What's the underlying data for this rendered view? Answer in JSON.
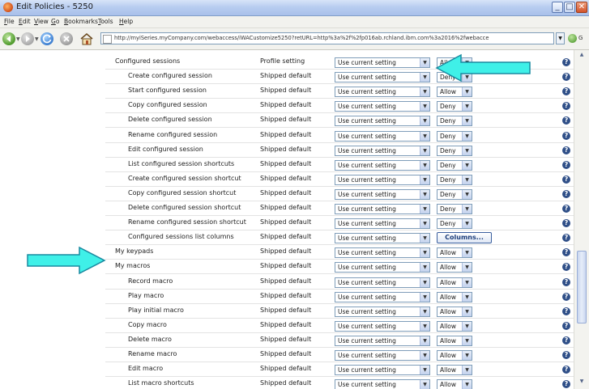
{
  "window": {
    "title": "Edit Policies - 5250"
  },
  "menu": [
    "File",
    "Edit",
    "View",
    "Go",
    "Bookmarks",
    "Tools",
    "Help"
  ],
  "address": {
    "url": "http://myiSeries.myCompany.com/webaccess/iWACustomize5250?retURL=http%3a%2f%2fp016ab.rchland.ibm.com%3a2016%2fwebacce",
    "go_label": "G"
  },
  "rows": [
    {
      "name": "Configured sessions",
      "indent": 0,
      "profile": "Profile setting",
      "setting": "Use current setting",
      "perm": "Allow"
    },
    {
      "name": "Create configured session",
      "indent": 1,
      "profile": "Shipped default",
      "setting": "Use current setting",
      "perm": "Deny"
    },
    {
      "name": "Start configured session",
      "indent": 1,
      "profile": "Shipped default",
      "setting": "Use current setting",
      "perm": "Allow"
    },
    {
      "name": "Copy configured session",
      "indent": 1,
      "profile": "Shipped default",
      "setting": "Use current setting",
      "perm": "Deny"
    },
    {
      "name": "Delete configured session",
      "indent": 1,
      "profile": "Shipped default",
      "setting": "Use current setting",
      "perm": "Deny"
    },
    {
      "name": "Rename configured session",
      "indent": 1,
      "profile": "Shipped default",
      "setting": "Use current setting",
      "perm": "Deny"
    },
    {
      "name": "Edit configured session",
      "indent": 1,
      "profile": "Shipped default",
      "setting": "Use current setting",
      "perm": "Deny"
    },
    {
      "name": "List configured session shortcuts",
      "indent": 1,
      "profile": "Shipped default",
      "setting": "Use current setting",
      "perm": "Deny"
    },
    {
      "name": "Create configured session shortcut",
      "indent": 1,
      "profile": "Shipped default",
      "setting": "Use current setting",
      "perm": "Deny"
    },
    {
      "name": "Copy configured session shortcut",
      "indent": 1,
      "profile": "Shipped default",
      "setting": "Use current setting",
      "perm": "Deny"
    },
    {
      "name": "Delete configured session shortcut",
      "indent": 1,
      "profile": "Shipped default",
      "setting": "Use current setting",
      "perm": "Deny"
    },
    {
      "name": "Rename configured session shortcut",
      "indent": 1,
      "profile": "Shipped default",
      "setting": "Use current setting",
      "perm": "Deny"
    },
    {
      "name": "Configured sessions list columns",
      "indent": 1,
      "profile": "Shipped default",
      "setting": "Use current setting",
      "button": "Columns..."
    },
    {
      "name": "My keypads",
      "indent": 0,
      "profile": "Shipped default",
      "setting": "Use current setting",
      "perm": "Allow"
    },
    {
      "name": "My macros",
      "indent": 0,
      "profile": "Shipped default",
      "setting": "Use current setting",
      "perm": "Allow"
    },
    {
      "name": "Record macro",
      "indent": 1,
      "profile": "Shipped default",
      "setting": "Use current setting",
      "perm": "Allow"
    },
    {
      "name": "Play macro",
      "indent": 1,
      "profile": "Shipped default",
      "setting": "Use current setting",
      "perm": "Allow"
    },
    {
      "name": "Play initial macro",
      "indent": 1,
      "profile": "Shipped default",
      "setting": "Use current setting",
      "perm": "Allow"
    },
    {
      "name": "Copy macro",
      "indent": 1,
      "profile": "Shipped default",
      "setting": "Use current setting",
      "perm": "Allow"
    },
    {
      "name": "Delete macro",
      "indent": 1,
      "profile": "Shipped default",
      "setting": "Use current setting",
      "perm": "Allow"
    },
    {
      "name": "Rename macro",
      "indent": 1,
      "profile": "Shipped default",
      "setting": "Use current setting",
      "perm": "Allow"
    },
    {
      "name": "Edit macro",
      "indent": 1,
      "profile": "Shipped default",
      "setting": "Use current setting",
      "perm": "Allow"
    },
    {
      "name": "List macro shortcuts",
      "indent": 1,
      "profile": "Shipped default",
      "setting": "Use current setting",
      "perm": "Allow"
    }
  ],
  "annotations": [
    {
      "name": "callout-arrow-left",
      "points_at": "Configured sessions"
    },
    {
      "name": "callout-arrow-right",
      "points_at": "My keypads"
    }
  ],
  "colors": {
    "arrow_fill": "#3ff0e8",
    "arrow_stroke": "#1a8aa0",
    "help_icon": "#2f4f88"
  }
}
